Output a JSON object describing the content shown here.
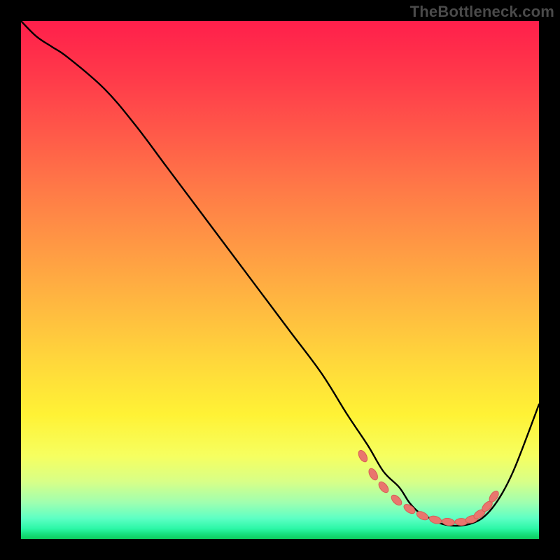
{
  "watermark": "TheBottleneck.com",
  "colors": {
    "curve": "#000000",
    "dot_fill": "#e9766e",
    "dot_stroke": "#d85e56"
  },
  "chart_data": {
    "type": "line",
    "title": "",
    "xlabel": "",
    "ylabel": "",
    "xlim": [
      0,
      100
    ],
    "ylim": [
      0,
      100
    ],
    "series": [
      {
        "name": "bottleneck-curve",
        "x": [
          0,
          3,
          6,
          9,
          16,
          22,
          28,
          34,
          40,
          46,
          52,
          58,
          63,
          67,
          70,
          73,
          75,
          77,
          79,
          81,
          83,
          85,
          87,
          89,
          91,
          93,
          95,
          97,
          100
        ],
        "y": [
          100,
          97,
          95,
          93,
          87,
          80,
          72,
          64,
          56,
          48,
          40,
          32,
          24,
          18,
          13,
          10,
          7,
          5,
          4,
          3,
          2.6,
          2.6,
          3,
          4,
          6,
          9,
          13,
          18,
          26
        ]
      }
    ],
    "dots": {
      "x": [
        66,
        68,
        70,
        72.5,
        75,
        77.5,
        80,
        82.5,
        85,
        87,
        88.5,
        90,
        91.3
      ],
      "y": [
        16,
        12.5,
        10,
        7.5,
        5.8,
        4.5,
        3.7,
        3.3,
        3.3,
        3.8,
        4.8,
        6.3,
        8.2
      ]
    }
  }
}
